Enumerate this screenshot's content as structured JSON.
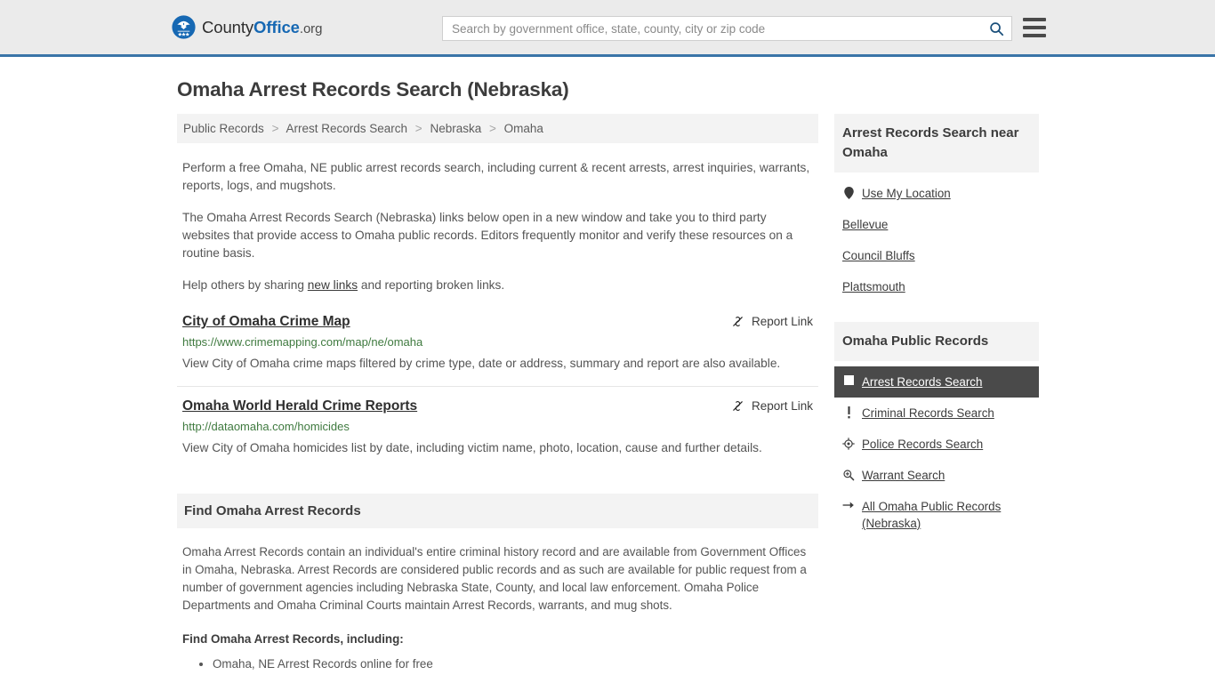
{
  "header": {
    "brand": {
      "part1": "County",
      "part2": "Office",
      "part3": ".org",
      "logo_icon": "eagle-badge-icon"
    },
    "search": {
      "placeholder": "Search by government office, state, county, city or zip code",
      "value": "",
      "icon": "search-icon"
    },
    "menu_icon": "hamburger-menu-icon",
    "accent_color": "#3a74a8",
    "background_color": "#ebebeb"
  },
  "page": {
    "title": "Omaha Arrest Records Search (Nebraska)"
  },
  "breadcrumb": {
    "items": [
      "Public Records",
      "Arrest Records Search",
      "Nebraska",
      "Omaha"
    ],
    "separator": ">"
  },
  "intro": {
    "p1": "Perform a free Omaha, NE public arrest records search, including current & recent arrests, arrest inquiries, warrants, reports, logs, and mugshots.",
    "p2": "The Omaha Arrest Records Search (Nebraska) links below open in a new window and take you to third party websites that provide access to Omaha public records. Editors frequently monitor and verify these resources on a routine basis.",
    "p3_before": "Help others by sharing ",
    "p3_link": "new links",
    "p3_after": " and reporting broken links."
  },
  "results": {
    "report_label": "Report Link",
    "report_icon": "broken-link-icon",
    "items": [
      {
        "title": "City of Omaha Crime Map",
        "url": "https://www.crimemapping.com/map/ne/omaha",
        "description": "View City of Omaha crime maps filtered by crime type, date or address, summary and report are also available."
      },
      {
        "title": "Omaha World Herald Crime Reports",
        "url": "http://dataomaha.com/homicides",
        "description": "View City of Omaha homicides list by date, including victim name, photo, location, cause and further details."
      }
    ]
  },
  "find_panel": {
    "heading": "Find Omaha Arrest Records",
    "body": "Omaha Arrest Records contain an individual's entire criminal history record and are available from Government Offices in Omaha, Nebraska. Arrest Records are considered public records and as such are available for public request from a number of government agencies including Nebraska State, County, and local law enforcement. Omaha Police Departments and Omaha Criminal Courts maintain Arrest Records, warrants, and mug shots.",
    "lead_in": "Find Omaha Arrest Records, including:",
    "bullets": [
      "Omaha, NE Arrest Records online for free"
    ]
  },
  "sidebar": {
    "near_card": {
      "heading": "Arrest Records Search near Omaha",
      "items": [
        {
          "label": "Use My Location",
          "icon": "map-pin-icon"
        },
        {
          "label": "Bellevue",
          "icon": ""
        },
        {
          "label": "Council Bluffs",
          "icon": ""
        },
        {
          "label": "Plattsmouth",
          "icon": ""
        }
      ]
    },
    "records_card": {
      "heading": "Omaha Public Records",
      "items": [
        {
          "label": "Arrest Records Search",
          "icon": "square-icon",
          "active": true
        },
        {
          "label": "Criminal Records Search",
          "icon": "exclamation-icon",
          "active": false
        },
        {
          "label": "Police Records Search",
          "icon": "crosshair-icon",
          "active": false
        },
        {
          "label": "Warrant Search",
          "icon": "magnifier-plus-icon",
          "active": false
        },
        {
          "label": "All Omaha Public Records (Nebraska)",
          "icon": "arrow-right-icon",
          "active": false
        }
      ],
      "active_background": "#4a4a4a"
    }
  }
}
